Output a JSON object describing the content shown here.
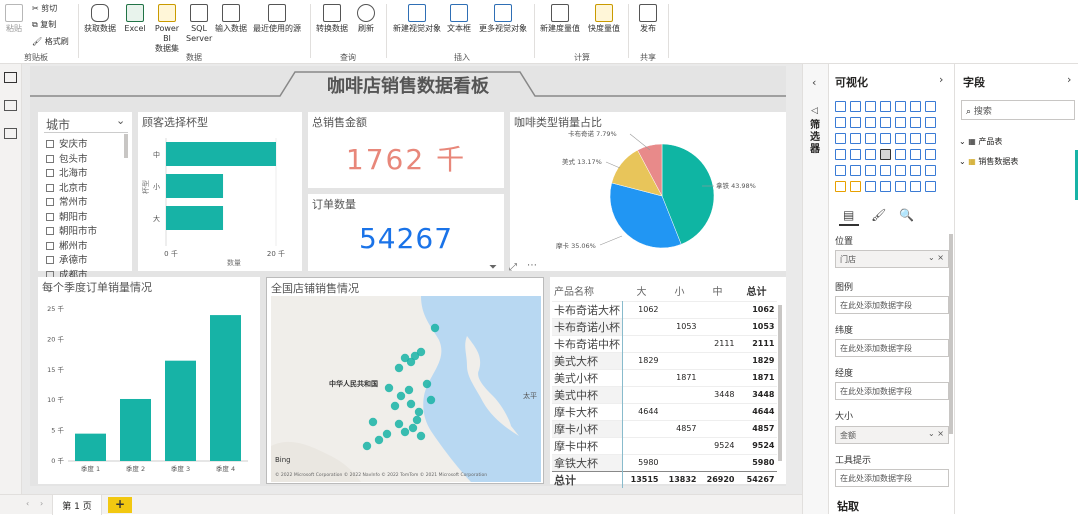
{
  "ribbon": {
    "clipboard": {
      "paste": "粘贴",
      "cut": "剪切",
      "copy": "复制",
      "format_painter": "格式刷",
      "group": "剪贴板"
    },
    "data": {
      "get_data": "获取数据",
      "excel": "Excel",
      "powerbi_line1": "Power BI",
      "powerbi_line2": "数据集",
      "sql_line1": "SQL",
      "sql_line2": "Server",
      "enter_data": "输入数据",
      "recent_sources": "最近使用的源",
      "group": "数据"
    },
    "query": {
      "transform": "转换数据",
      "refresh": "刷新",
      "group": "查询"
    },
    "insert": {
      "new_visual": "新建视觉对象",
      "text_box": "文本框",
      "more_visuals": "更多视觉对象",
      "group": "插入"
    },
    "calc": {
      "new_measure": "新建度量值",
      "quick_measure": "快度量值",
      "group": "计算"
    },
    "share": {
      "publish": "发布",
      "group": "共享"
    }
  },
  "report": {
    "title": "咖啡店销售数据看板",
    "city_slicer": {
      "header": "城市",
      "items": [
        "安庆市",
        "包头市",
        "北海市",
        "北京市",
        "常州市",
        "朝阳市",
        "朝阳市市",
        "郴州市",
        "承德市",
        "成都市"
      ]
    },
    "cup_chart": {
      "title": "顾客选择杯型",
      "ylabel": "杯型",
      "xlabel": "数量",
      "categories": [
        "中",
        "小",
        "大"
      ],
      "ticks": [
        "0 千",
        "20 千"
      ]
    },
    "total_sales": {
      "title": "总销售金额",
      "value": "1762 千",
      "color": "#e8877a"
    },
    "order_count": {
      "title": "订单数量",
      "value": "54267",
      "color": "#1a73e8"
    },
    "pie": {
      "title": "咖啡类型销量占比",
      "labels": [
        "卡布奇诺 7.79%",
        "美式 13.17%",
        "拿铁 43.98%",
        "摩卡 35.06%"
      ]
    },
    "quarter_chart": {
      "title": "每个季度订单销量情况",
      "yticks": [
        "25 千",
        "20 千",
        "15 千",
        "10 千",
        "5 千",
        "0 千"
      ],
      "categories": [
        "季度 1",
        "季度 2",
        "季度 3",
        "季度 4"
      ]
    },
    "map": {
      "title": "全国店铺销售情况",
      "country_label": "中华人民共和国",
      "sea_label": "太平",
      "bing": "Bing",
      "copyright": "© 2022 Microsoft Corporation  © 2022 NavInfo  © 2022 TomTom  © 2021 Microsoft Corporation"
    },
    "matrix": {
      "headers": [
        "产品名称",
        "大",
        "小",
        "中",
        "总计"
      ],
      "rows": [
        [
          "卡布奇诺大杯",
          "1062",
          "",
          "",
          "1062"
        ],
        [
          "卡布奇诺小杯",
          "",
          "1053",
          "",
          "1053"
        ],
        [
          "卡布奇诺中杯",
          "",
          "",
          "2111",
          "2111"
        ],
        [
          "美式大杯",
          "1829",
          "",
          "",
          "1829"
        ],
        [
          "美式小杯",
          "",
          "1871",
          "",
          "1871"
        ],
        [
          "美式中杯",
          "",
          "",
          "3448",
          "3448"
        ],
        [
          "摩卡大杯",
          "4644",
          "",
          "",
          "4644"
        ],
        [
          "摩卡小杯",
          "",
          "4857",
          "",
          "4857"
        ],
        [
          "摩卡中杯",
          "",
          "",
          "9524",
          "9524"
        ],
        [
          "拿铁大杯",
          "5980",
          "",
          "",
          "5980"
        ]
      ],
      "total": [
        "总计",
        "13515",
        "13832",
        "26920",
        "54267"
      ]
    }
  },
  "chart_data": [
    {
      "type": "bar",
      "title": "顾客选择杯型",
      "xlabel": "数量",
      "ylabel": "杯型",
      "categories": [
        "中",
        "小",
        "大"
      ],
      "values": [
        27.0,
        14.0,
        14.0
      ],
      "xlim": [
        0,
        27
      ]
    },
    {
      "type": "pie",
      "title": "咖啡类型销量占比",
      "categories": [
        "拿铁",
        "摩卡",
        "美式",
        "卡布奇诺"
      ],
      "values": [
        43.98,
        35.06,
        13.17,
        7.79
      ],
      "colors": [
        "#0fb5a3",
        "#2196f3",
        "#e8c55a",
        "#e88a8a"
      ]
    },
    {
      "type": "bar",
      "title": "每个季度订单销量情况",
      "categories": [
        "季度 1",
        "季度 2",
        "季度 3",
        "季度 4"
      ],
      "values": [
        4.5,
        10.2,
        16.5,
        24.0
      ],
      "ylim": [
        0,
        25
      ]
    }
  ],
  "bottom": {
    "page_tab": "第 1 页",
    "add_page": "+"
  },
  "filters": {
    "label": "筛选器"
  },
  "viz": {
    "header": "可视化",
    "location_label": "位置",
    "location_value": "门店",
    "legend_label": "图例",
    "legend_placeholder": "在此处添加数据字段",
    "lat_label": "纬度",
    "lat_placeholder": "在此处添加数据字段",
    "lon_label": "经度",
    "lon_placeholder": "在此处添加数据字段",
    "size_label": "大小",
    "size_value": "金额",
    "tooltip_label": "工具提示",
    "tooltip_placeholder": "在此处添加数据字段",
    "drill_label": "钻取"
  },
  "fields": {
    "header": "字段",
    "search_placeholder": "搜索",
    "tables": [
      "产品表",
      "销售数据表"
    ]
  },
  "colors": {
    "accent": "#17b3a6",
    "brand_yellow": "#f2c811"
  }
}
